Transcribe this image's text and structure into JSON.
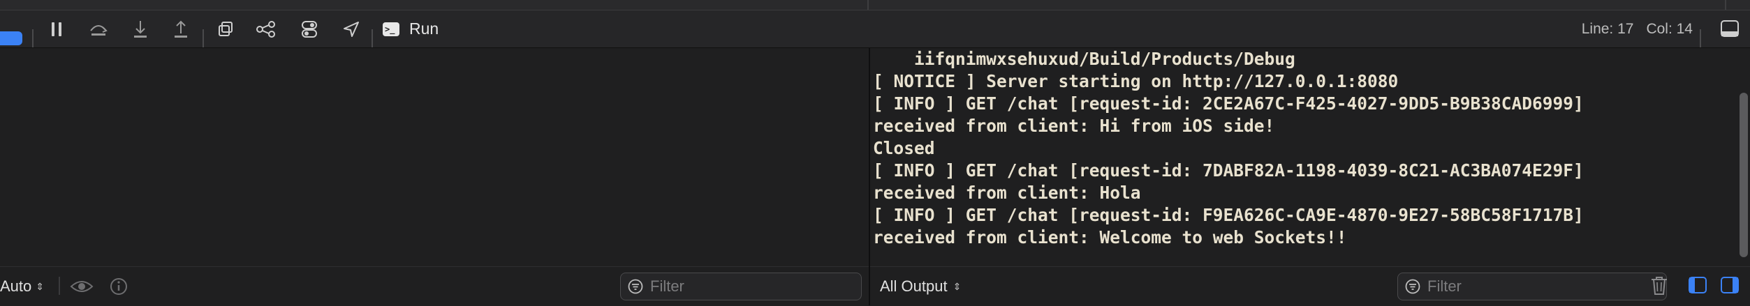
{
  "toolbar": {
    "run_label": "Run",
    "line_label": "Line: 17",
    "col_label": "Col: 14",
    "icons": [
      "breakpoints-toggle-icon",
      "pause-icon",
      "step-over-icon",
      "step-into-icon",
      "step-out-icon",
      "view-hierarchy-icon",
      "memory-graph-icon",
      "environment-overrides-icon",
      "location-icon",
      "terminal-icon",
      "panel-toggle-icon"
    ]
  },
  "console": {
    "lines": [
      "    iifqnimwxsehuxud/Build/Products/Debug",
      "[ NOTICE ] Server starting on http://127.0.0.1:8080",
      "[ INFO ] GET /chat [request-id: 2CE2A67C-F425-4027-9DD5-B9B38CAD6999]",
      "received from client: Hi from iOS side!",
      "Closed",
      "[ INFO ] GET /chat [request-id: 7DABF82A-1198-4039-8C21-AC3BA074E29F]",
      "received from client: Hola",
      "[ INFO ] GET /chat [request-id: F9EA626C-CA9E-4870-9E27-58BC58F1717B]",
      "received from client: Welcome to web Sockets!!"
    ]
  },
  "variables_bar": {
    "scope_select": "Auto",
    "filter_placeholder": "Filter"
  },
  "console_bar": {
    "output_select": "All Output",
    "filter_placeholder": "Filter"
  },
  "colors": {
    "accent": "#3b82f6",
    "console_text": "#e9e2cf",
    "background": "#1f1f20"
  }
}
